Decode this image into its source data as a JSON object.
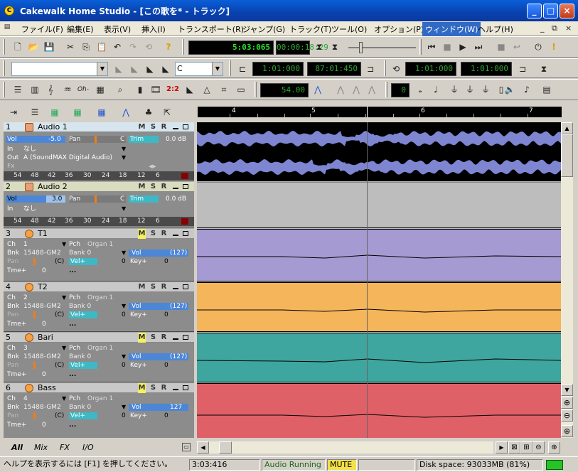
{
  "window": {
    "title": "Cakewalk Home Studio - [この歌を* - トラック]",
    "app_icon": "C"
  },
  "menu": {
    "items": [
      "ファイル(F)",
      "編集(E)",
      "表示(V)",
      "挿入(I)",
      "トランスポート(R)",
      "ジャンプ(G)",
      "トラック(T)",
      "ツール(O)",
      "オプション(P)",
      "ウィンドウ(W)",
      "ヘルプ(H)"
    ],
    "active": "ウィンドウ(W)"
  },
  "transport": {
    "now_time": "5:03:065",
    "smpte": "00:00:18:29",
    "from": "1:01:000",
    "thru": "87:01:450",
    "loop_start": "1:01:000",
    "loop_end": "1:01:000",
    "tempo": "54.00",
    "meter": "0",
    "key_combo": "C"
  },
  "ruler": {
    "marks": [
      "4",
      "5",
      "6",
      "7"
    ]
  },
  "tracks": [
    {
      "num": "1",
      "name": "Audio 1",
      "type": "audio",
      "vol_label": "Vol",
      "vol": "-5.0",
      "pan_label": "Pan",
      "pan": "C",
      "trim_label": "Trim",
      "trim": "0.0 dB",
      "in_label": "In",
      "in": "なし",
      "out_label": "Out",
      "out": "A (SoundMAX Digital Audio)",
      "fx_label": "Fx",
      "meter": [
        "54",
        "48",
        "42",
        "36",
        "30",
        "24",
        "18",
        "12",
        "6"
      ]
    },
    {
      "num": "2",
      "name": "Audio 2",
      "type": "audio",
      "vol_label": "Vol",
      "vol": "3.0",
      "pan_label": "Pan",
      "pan": "C",
      "trim_label": "Trim",
      "trim": "0.0 dB",
      "in_label": "In",
      "in": "なし",
      "meter": [
        "54",
        "48",
        "42",
        "36",
        "30",
        "24",
        "18",
        "12",
        "6"
      ]
    },
    {
      "num": "3",
      "name": "T1",
      "type": "midi",
      "ch": "1",
      "pch": "Organ 1",
      "bnk": "15488-GM2",
      "bank": "Bank 0",
      "vol": "(127)",
      "pan": "(C)",
      "vel": "0",
      "key": "0",
      "tme": "0",
      "mute": true
    },
    {
      "num": "4",
      "name": "T2",
      "type": "midi",
      "ch": "2",
      "pch": "Organ 1",
      "bnk": "15488-GM2",
      "bank": "Bank 0",
      "vol": "(127)",
      "pan": "(C)",
      "vel": "0",
      "key": "0",
      "tme": "0",
      "mute": false
    },
    {
      "num": "5",
      "name": "Bari",
      "type": "midi",
      "ch": "3",
      "pch": "Organ 1",
      "bnk": "15488-GM2",
      "bank": "Bank 0",
      "vol": "(127)",
      "pan": "(C)",
      "vel": "0",
      "key": "0",
      "tme": "0",
      "mute": true
    },
    {
      "num": "6",
      "name": "Bass",
      "type": "midi",
      "ch": "4",
      "pch": "Organ 1",
      "bnk": "15488-GM2",
      "bank": "Bank 0",
      "vol": "127",
      "pan": "(C)",
      "vel": "0",
      "key": "0",
      "tme": "0",
      "mute": true
    }
  ],
  "labels": {
    "m": "M",
    "s": "S",
    "r": "R",
    "ch": "Ch",
    "pch": "Pch",
    "bnk": "Bnk",
    "vol": "Vol",
    "pan": "Pan",
    "vel": "Vel+",
    "key": "Key+",
    "tme": "Tme+",
    "dots": "..."
  },
  "tabs": [
    "All",
    "Mix",
    "FX",
    "I/O"
  ],
  "status": {
    "help": "ヘルプを表示するには [F1] を押してください。",
    "time": "3:03:416",
    "engine": "Audio Running",
    "mute": "MUTE",
    "disk": "Disk space: 93033MB (81%)"
  },
  "colors": {
    "audio1_clip": "#000000",
    "audio2_clip": "#bdbdbd",
    "t1": "#a59ad2",
    "t2": "#f5b55a",
    "bari": "#3fa59f",
    "bass": "#e06068",
    "wave": "#7e86d2"
  }
}
